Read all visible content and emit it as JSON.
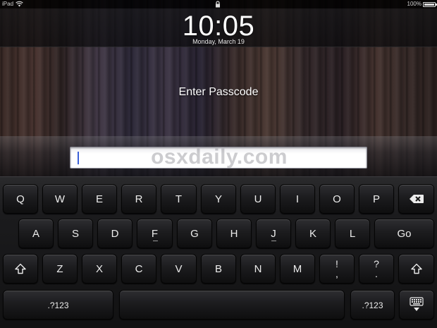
{
  "status_bar": {
    "device": "iPad",
    "battery_text": "100%",
    "icons": [
      "wifi-icon",
      "lock-icon",
      "battery-icon"
    ]
  },
  "lock_screen": {
    "time": "10:05",
    "date": "Monday, March 19",
    "prompt": "Enter Passcode",
    "passcode_value": "",
    "watermark": "osxdaily.com"
  },
  "keyboard": {
    "row1": [
      "Q",
      "W",
      "E",
      "R",
      "T",
      "Y",
      "U",
      "I",
      "O",
      "P"
    ],
    "row2": [
      "A",
      "S",
      "D",
      "F",
      "G",
      "H",
      "J",
      "K",
      "L"
    ],
    "go_label": "Go",
    "row3": [
      "Z",
      "X",
      "C",
      "V",
      "B",
      "N",
      "M"
    ],
    "punct1": {
      "top": "!",
      "bottom": ","
    },
    "punct2": {
      "top": "?",
      "bottom": "."
    },
    "numbers_label": ".?123",
    "icons": [
      "backspace-icon",
      "shift-icon",
      "keyboard-hide-icon"
    ]
  }
}
